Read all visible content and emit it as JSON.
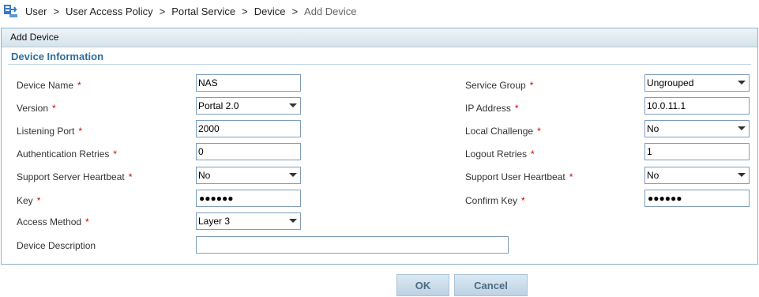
{
  "breadcrumb": {
    "items": [
      "User",
      "User Access Policy",
      "Portal Service",
      "Device",
      "Add Device"
    ],
    "separator": ">"
  },
  "panel": {
    "title": "Add Device",
    "section_title": "Device Information"
  },
  "form": {
    "device_name": {
      "label": "Device Name",
      "value": "NAS"
    },
    "service_group": {
      "label": "Service Group",
      "value": "Ungrouped"
    },
    "version": {
      "label": "Version",
      "value": "Portal 2.0"
    },
    "ip_address": {
      "label": "IP Address",
      "value": "10.0.11.1"
    },
    "listening_port": {
      "label": "Listening Port",
      "value": "2000"
    },
    "local_challenge": {
      "label": "Local Challenge",
      "value": "No"
    },
    "auth_retries": {
      "label": "Authentication Retries",
      "value": "0"
    },
    "logout_retries": {
      "label": "Logout Retries",
      "value": "1"
    },
    "server_heartbeat": {
      "label": "Support Server Heartbeat",
      "value": "No"
    },
    "user_heartbeat": {
      "label": "Support User Heartbeat",
      "value": "No"
    },
    "key": {
      "label": "Key",
      "masked": "●●●●●●"
    },
    "confirm_key": {
      "label": "Confirm Key",
      "masked": "●●●●●●"
    },
    "access_method": {
      "label": "Access Method",
      "value": "Layer 3"
    },
    "device_description": {
      "label": "Device Description",
      "value": ""
    },
    "required_mark": "*"
  },
  "buttons": {
    "ok": "OK",
    "cancel": "Cancel"
  },
  "colors": {
    "section_title": "#2e6e9e",
    "required": "#d00000",
    "border": "#7f9db9"
  }
}
